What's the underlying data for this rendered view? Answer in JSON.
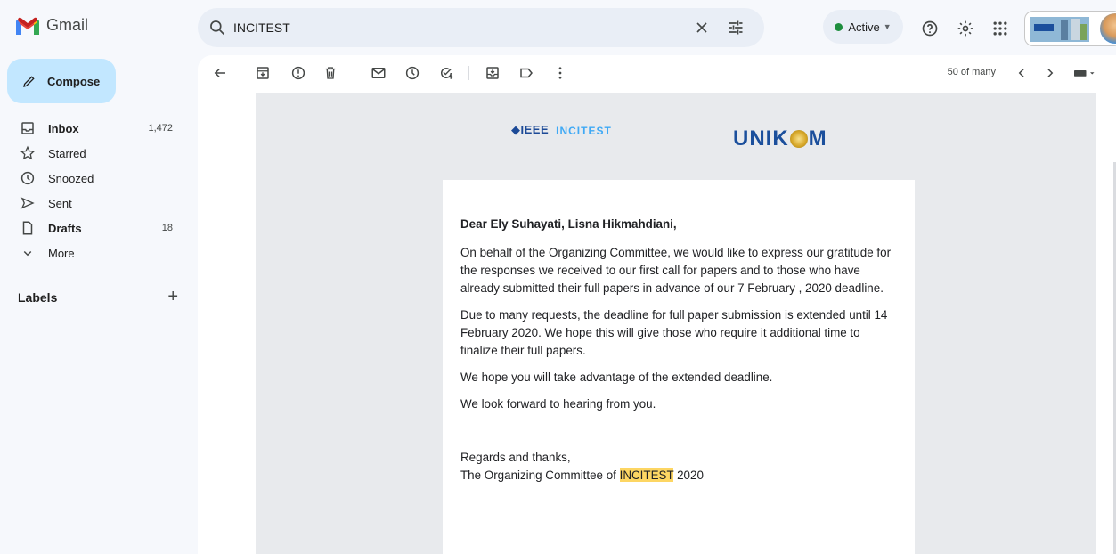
{
  "app": {
    "name": "Gmail"
  },
  "search": {
    "query": "INCITEST"
  },
  "status": {
    "label": "Active"
  },
  "compose": {
    "label": "Compose"
  },
  "nav": {
    "inbox": {
      "label": "Inbox",
      "count": "1,472"
    },
    "starred": {
      "label": "Starred"
    },
    "snoozed": {
      "label": "Snoozed"
    },
    "sent": {
      "label": "Sent"
    },
    "drafts": {
      "label": "Drafts",
      "count": "18"
    },
    "more": {
      "label": "More"
    }
  },
  "labels": {
    "title": "Labels"
  },
  "pager": {
    "text": "50 of many"
  },
  "email": {
    "logo_ieee": "◆IEEE",
    "logo_incitest": "INCITEST",
    "logo_unikom_left": "UNIK",
    "logo_unikom_right": "M",
    "greeting": "Dear Ely Suhayati, Lisna Hikmahdiani,",
    "p1": "On behalf of the Organizing Committee, we would like to express our gratitude for the responses we received to our first call for papers and to those who have already submitted their full papers in advance of our 7 February , 2020 deadline.",
    "p2": "Due to many requests, the deadline for full paper submission is extended until 14 February 2020.   We hope this will give those who require it additional time to finalize their full papers.",
    "p3": "We hope you will take advantage of the extended deadline.",
    "p4": "We look forward to hearing from you.",
    "regards": "Regards and thanks,",
    "signature_prefix": "The Organizing Committee of ",
    "signature_highlight": "INCITEST",
    "signature_suffix": " 2020"
  },
  "colors": {
    "accent": "#c2e7ff",
    "search_bg": "#e9eef6",
    "highlight": "#fdd663",
    "active_dot": "#1e8e3e"
  }
}
